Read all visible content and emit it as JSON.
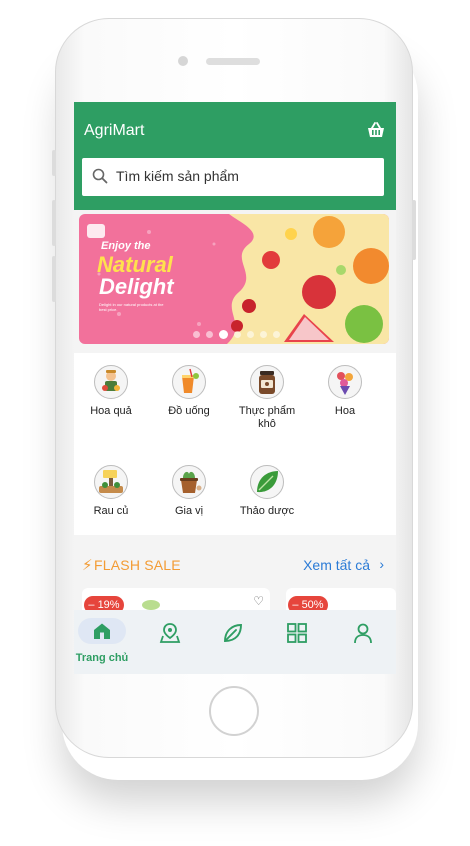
{
  "header": {
    "title": "AgriMart",
    "cart_icon": "basket-icon",
    "background": "#2e9e63"
  },
  "search": {
    "placeholder": "Tìm kiếm sản phẩm",
    "icon": "search-icon"
  },
  "banner": {
    "headline_top": "Enjoy the",
    "headline_main": "Natural",
    "headline_sub": "Delight",
    "tagline": "Delight in our natural products at the best price.",
    "slide_count": 7,
    "active_slide": 3
  },
  "categories": [
    {
      "label": "Hoa quả",
      "icon": "farmer-fruit-icon"
    },
    {
      "label": "Đồ uống",
      "icon": "drink-icon"
    },
    {
      "label": "Thực phẩm khô",
      "icon": "dry-food-jar-icon"
    },
    {
      "label": "Hoa",
      "icon": "flower-bouquet-icon"
    },
    {
      "label": "Rau củ",
      "icon": "vegetable-garden-icon"
    },
    {
      "label": "Gia vị",
      "icon": "spice-pot-icon"
    },
    {
      "label": "Thảo dược",
      "icon": "herb-leaf-icon"
    }
  ],
  "flash_sale": {
    "title": "FLASH SALE",
    "see_all": "Xem tất cả",
    "products": [
      {
        "discount": "– 19%"
      },
      {
        "discount": "– 50%"
      }
    ]
  },
  "navbar": {
    "items": [
      {
        "label": "Trang chủ",
        "icon": "home-icon",
        "active": true
      },
      {
        "label": "",
        "icon": "map-pin-icon",
        "active": false
      },
      {
        "label": "",
        "icon": "leaf-icon",
        "active": false
      },
      {
        "label": "",
        "icon": "grid-icon",
        "active": false
      },
      {
        "label": "",
        "icon": "user-icon",
        "active": false
      }
    ],
    "accent": "#2e9e63"
  }
}
